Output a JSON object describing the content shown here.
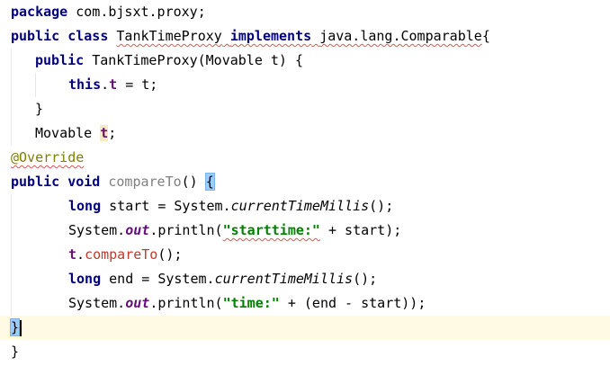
{
  "editor": {
    "language": "java",
    "colors": {
      "keyword": "#000080",
      "field": "#660e7a",
      "string": "#008000",
      "annotation": "#808000",
      "unused_method": "#808080",
      "warning_underline": "#e05555",
      "current_line": "#fffae3",
      "brace_match": "#99ccff"
    },
    "lines": [
      {
        "kw1": "package",
        "rest": " com.bjsxt.proxy;"
      },
      {
        "kw_public": "public",
        "kw_class": "class",
        "class_name": "TankTimeProxy",
        "kw_implements": "implements",
        "iface": "java.lang.Comparable",
        "brace": "{"
      },
      {
        "kw_public": "public",
        "ctor": "TankTimeProxy(Movable t) {"
      },
      {
        "kw_this": "this",
        "dot": ".",
        "field": "t",
        "rest": " = t;"
      },
      {
        "close": "}"
      },
      {
        "type": "Movable ",
        "field": "t",
        "semi": ";"
      },
      {
        "annotation": "@Override"
      },
      {
        "kw_public": "public",
        "kw_void": "void",
        "method": "compareTo",
        "parens": "() ",
        "brace": "{"
      },
      {
        "kw_long": "long",
        "pre": " start = System.",
        "call": "currentTimeMillis",
        "post": "();"
      },
      {
        "pre": "System.",
        "field": "out",
        "mid": ".println(",
        "str": "\"starttime:\"",
        "post": " + start);"
      },
      {
        "field": "t",
        "dot": ".",
        "call": "compareTo",
        "post": "();"
      },
      {
        "kw_long": "long",
        "pre": " end = System.",
        "call": "currentTimeMillis",
        "post": "();"
      },
      {
        "pre": "System.",
        "field": "out",
        "mid": ".println(",
        "str": "\"time:\"",
        "post": " + (end - start));"
      },
      {
        "brace": "}"
      },
      {
        "brace": "}"
      }
    ]
  }
}
